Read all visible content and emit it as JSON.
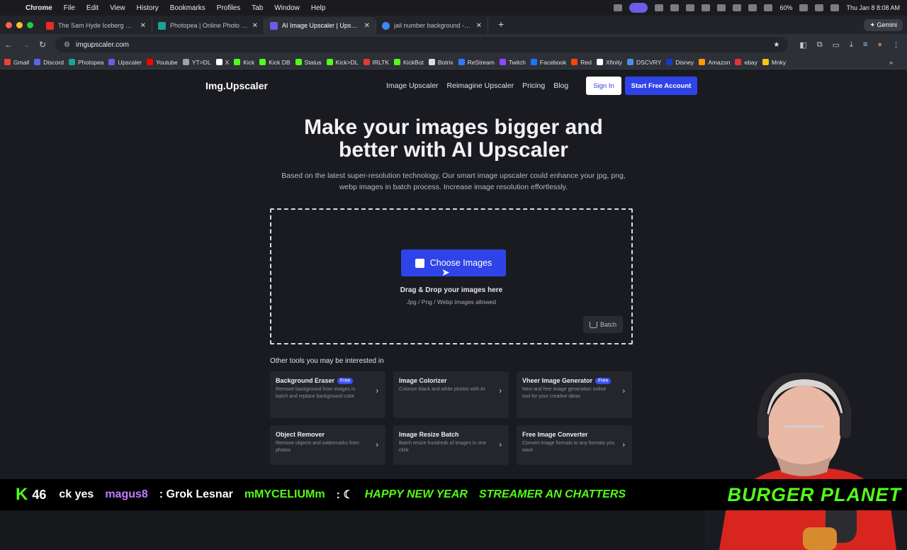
{
  "menubar": {
    "app": "Chrome",
    "items": [
      "File",
      "Edit",
      "View",
      "History",
      "Bookmarks",
      "Profiles",
      "Tab",
      "Window",
      "Help"
    ],
    "battery": "60%",
    "clock": "Thu Jan 8  8:08 AM"
  },
  "tabs": [
    {
      "title": "The Sam Hyde Iceberg Explai",
      "color": "#e52d27"
    },
    {
      "title": "Photopea | Online Photo Edit",
      "color": "#18a497"
    },
    {
      "title": "AI Image Upscaler | Upscale I",
      "color": "#6c5ce7"
    },
    {
      "title": "jail number background - Goo",
      "color": "#4285f4"
    }
  ],
  "gemini_label": "Gemini",
  "address": "imgupscaler.com",
  "bookmarks": [
    {
      "label": "Gmail",
      "color": "#ea4335"
    },
    {
      "label": "Discord",
      "color": "#5865f2"
    },
    {
      "label": "Photopea",
      "color": "#18a497"
    },
    {
      "label": "Upscaler",
      "color": "#6c5ce7"
    },
    {
      "label": "Youtube",
      "color": "#ff0000"
    },
    {
      "label": "YT>DL",
      "color": "#a0a0a8"
    },
    {
      "label": "X",
      "color": "#ffffff"
    },
    {
      "label": "Kick",
      "color": "#53fc18"
    },
    {
      "label": "Kick DB",
      "color": "#53fc18"
    },
    {
      "label": "Status",
      "color": "#53fc18"
    },
    {
      "label": "Kick>DL",
      "color": "#53fc18"
    },
    {
      "label": "IRLTK",
      "color": "#e53935"
    },
    {
      "label": "KickBot",
      "color": "#53fc18"
    },
    {
      "label": "Botrix",
      "color": "#dddddd"
    },
    {
      "label": "ReStream",
      "color": "#2f7bf5"
    },
    {
      "label": "Twitch",
      "color": "#9146ff"
    },
    {
      "label": "Facebook",
      "color": "#1877f2"
    },
    {
      "label": "Red",
      "color": "#ff4500"
    },
    {
      "label": "Xfinity",
      "color": "#ffffff"
    },
    {
      "label": "DSCVRY",
      "color": "#4a90e2"
    },
    {
      "label": "Disney",
      "color": "#113ccf"
    },
    {
      "label": "Amazon",
      "color": "#ff9900"
    },
    {
      "label": "ebay",
      "color": "#e53238"
    },
    {
      "label": "Mnky",
      "color": "#f5c518"
    }
  ],
  "site": {
    "logo": "Img.Upscaler",
    "nav": [
      "Image Upscaler",
      "Reimagine Upscaler",
      "Pricing",
      "Blog"
    ],
    "sign_in": "Sign In",
    "start_free": "Start Free Account"
  },
  "hero": {
    "title_line1": "Make your images bigger and",
    "title_line2": "better with AI Upscaler",
    "subtitle_line1": "Based on the latest super-resolution technology, Our smart image upscaler could enhance your jpg, png,",
    "subtitle_line2": "webp images in batch process. Increase image resolution effortlessly."
  },
  "upload": {
    "choose_label": "Choose Images",
    "drag_title": "Drag & Drop your images here",
    "formats_note": "Jpg / Png / Webp images allowed",
    "batch_label": "Batch"
  },
  "tools": {
    "heading": "Other tools you may be interested in",
    "items": [
      {
        "title": "Background Eraser",
        "badge": "Free",
        "desc": "Remove background from images in batch and replace background color"
      },
      {
        "title": "Image Colorizer",
        "badge": "",
        "desc": "Colorize black and white photos with AI"
      },
      {
        "title": "Vheer Image Generator",
        "badge": "Free",
        "desc": "New and free image generation online tool for your creative ideas"
      },
      {
        "title": "Object Remover",
        "badge": "",
        "desc": "Remove objects and watermarks from photos"
      },
      {
        "title": "Image Resize Batch",
        "badge": "",
        "desc": "Batch resize hundreds of images in one click"
      },
      {
        "title": "Free Image Converter",
        "badge": "",
        "desc": "Convert image formats to any formats you want"
      }
    ]
  },
  "ticker": {
    "viewer_count": "46",
    "segments": [
      {
        "text": "ck yes",
        "color": "#ffffff"
      },
      {
        "text": "magus8",
        "color": "#c27cff"
      },
      {
        "text": ": Grok Lesnar",
        "color": "#ffffff"
      },
      {
        "text": "mMYCELIUMm",
        "color": "#53fc18"
      },
      {
        "text": ": ☾",
        "color": "#ffffff"
      },
      {
        "text": "HAPPY NEW YEAR",
        "color": "#53fc18"
      },
      {
        "text": "STREAMER AN CHATTERS",
        "color": "#53fc18"
      }
    ],
    "banner": "BURGER PLANET"
  }
}
